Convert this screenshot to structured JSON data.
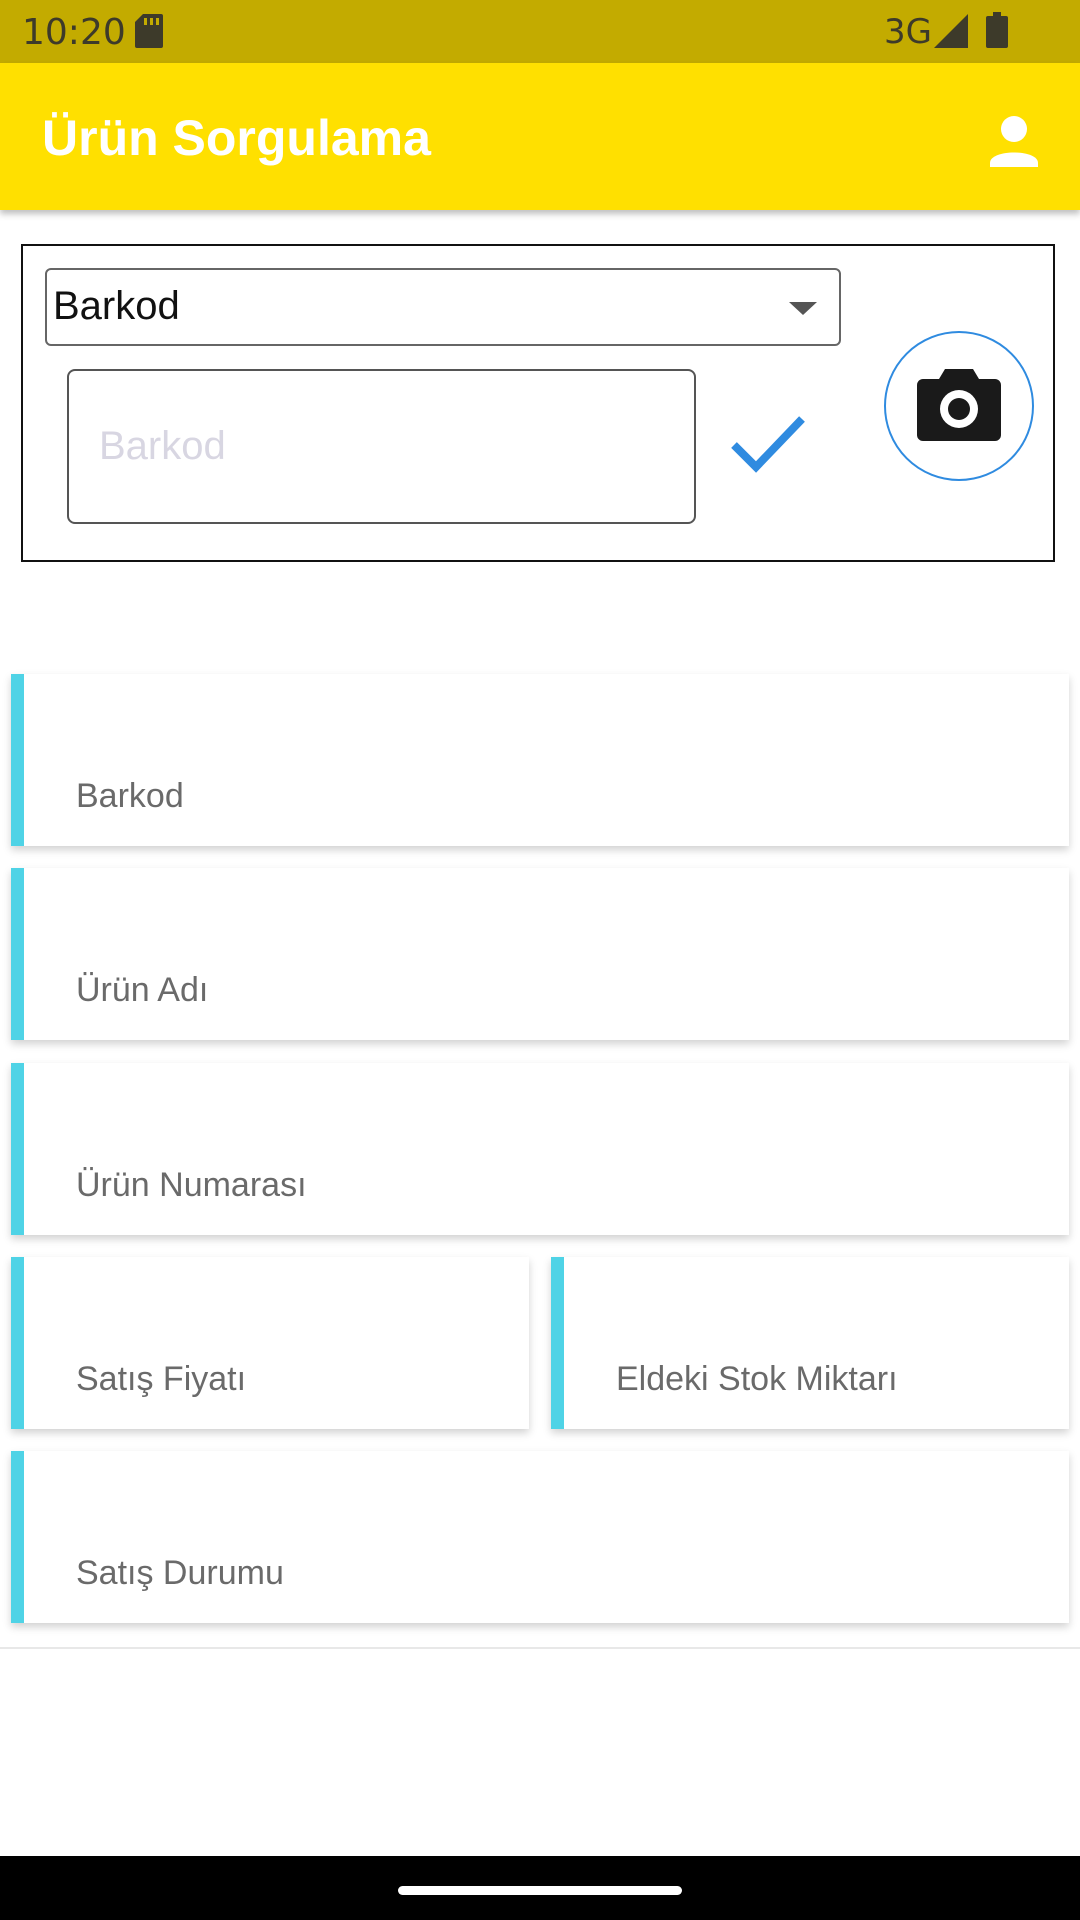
{
  "status_bar": {
    "time": "10:20",
    "network": "3G"
  },
  "app_bar": {
    "title": "Ürün Sorgulama"
  },
  "search": {
    "type_selected": "Barkod",
    "input_value": "",
    "input_placeholder": "Barkod"
  },
  "fields": {
    "barkod": "Barkod",
    "urun_adi": "Ürün Adı",
    "urun_numarasi": "Ürün Numarası",
    "satis_fiyati": "Satış Fiyatı",
    "stok_miktari": "Eldeki Stok Miktarı",
    "satis_durumu": "Satış Durumu"
  },
  "colors": {
    "status_bar": "#c3ab00",
    "app_bar": "#ffe000",
    "accent": "#4fd3e6",
    "confirm": "#2f8be0"
  },
  "icons": [
    "sd-card-icon",
    "signal-icon",
    "battery-icon",
    "account-icon",
    "chevron-down-icon",
    "check-icon",
    "camera-icon"
  ]
}
